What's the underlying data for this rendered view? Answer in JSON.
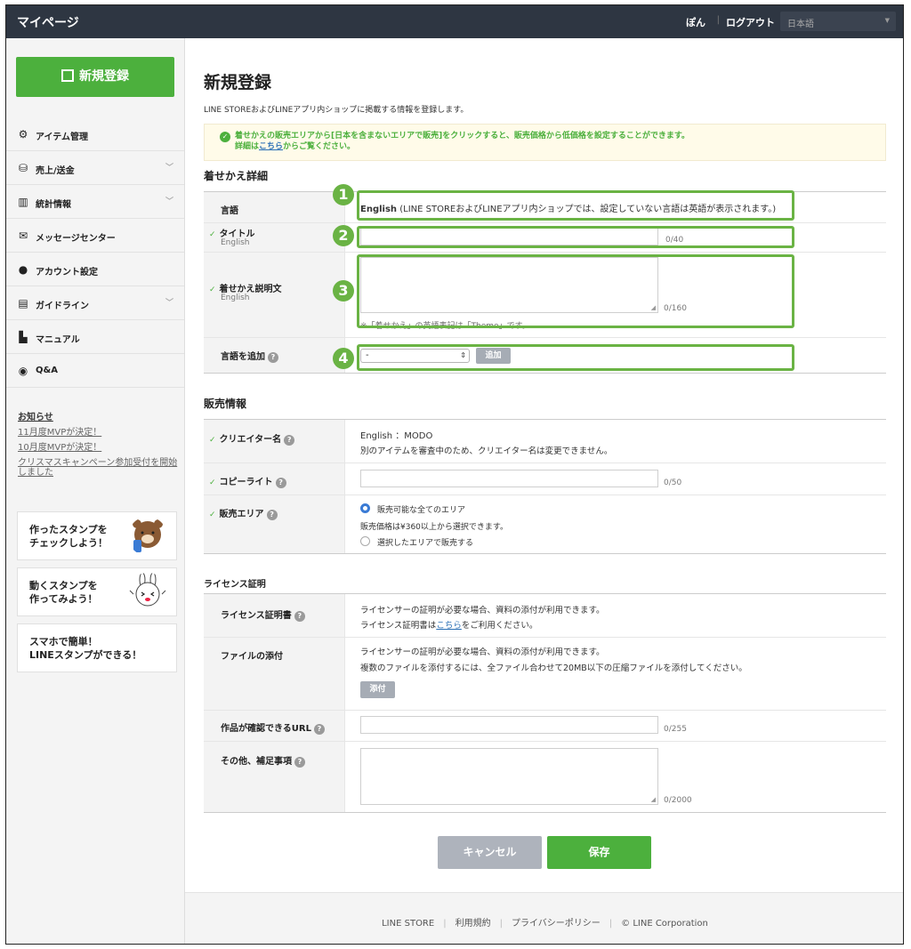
{
  "topbar": {
    "title": "マイページ",
    "user": "ぽん",
    "separator": "|",
    "logout": "ログアウト",
    "language": "日本語"
  },
  "sidebar": {
    "new_button": "新規登録",
    "menu": [
      {
        "label": "アイテム管理",
        "icon": "gear-icon"
      },
      {
        "label": "売上/送金",
        "icon": "coins-icon",
        "chevron": "﹀"
      },
      {
        "label": "統計情報",
        "icon": "bar-chart-icon",
        "chevron": "﹀"
      },
      {
        "label": "メッセージセンター",
        "icon": "envelope-icon"
      },
      {
        "label": "アカウント設定",
        "icon": "person-icon"
      },
      {
        "label": "ガイドライン",
        "icon": "document-icon",
        "chevron": "﹀"
      },
      {
        "label": "マニュアル",
        "icon": "file-icon"
      },
      {
        "label": "Q&A",
        "icon": "speech-bubble-icon"
      }
    ],
    "notice": {
      "heading": "お知らせ",
      "links": [
        "11月度MVPが決定！",
        "10月度MVPが決定！",
        "クリスマスキャンペーン参加受付を開始しました"
      ]
    },
    "banners": [
      {
        "line1": "作ったスタンプを",
        "line2": "チェックしよう！"
      },
      {
        "line1": "動くスタンプを",
        "line2": "作ってみよう！"
      },
      {
        "line1": "スマホで簡単！",
        "line2": "LINEスタンプができる！"
      }
    ]
  },
  "main": {
    "title": "新規登録",
    "subtitle": "LINE STOREおよびLINEアプリ内ショップに掲載する情報を登録します。",
    "alert": {
      "line1": "着せかえの販売エリアから[日本を含まないエリアで販売]をクリックすると、販売価格から低価格を設定することができます。",
      "line2_pre": "詳細は",
      "line2_link": "こちら",
      "line2_post": "からご覧ください。"
    },
    "theme_section": {
      "heading": "着せかえ詳細",
      "language_label": "言語",
      "language_value": "English",
      "language_note": "(LINE STOREおよびLINEアプリ内ショップでは、設定していない言語は英語が表示されます。)",
      "title_label": "タイトル",
      "title_sub": "English",
      "title_counter": "0/40",
      "desc_label": "着せかえ説明文",
      "desc_sub": "English",
      "desc_counter": "0/160",
      "desc_note": "※「着せかえ」の英語表記は「Theme」です。",
      "add_lang_label": "言語を追加",
      "add_lang_select": "-",
      "add_button": "追加",
      "badges": [
        "1",
        "2",
        "3",
        "4"
      ]
    },
    "sales_section": {
      "heading": "販売情報",
      "creator_label": "クリエイター名",
      "creator_value": "English ：MODO",
      "creator_note": "別のアイテムを審査中のため、クリエイター名は変更できません。",
      "copyright_label": "コピーライト",
      "copyright_counter": "0/50",
      "area_label": "販売エリア",
      "area_option1": "販売可能な全てのエリア",
      "area_price_note": "販売価格は¥360以上から選択できます。",
      "area_option2": "選択したエリアで販売する"
    },
    "license_section": {
      "heading": "ライセンス証明",
      "cert_label": "ライセンス証明書",
      "cert_line1": "ライセンサーの証明が必要な場合、資料の添付が利用できます。",
      "cert_line2_pre": "ライセンス証明書は",
      "cert_line2_link": "こちら",
      "cert_line2_post": "をご利用ください。",
      "file_label": "ファイルの添付",
      "file_line1": "ライセンサーの証明が必要な場合、資料の添付が利用できます。",
      "file_line2": "複数のファイルを添付するには、全ファイル合わせて20MB以下の圧縮ファイルを添付してください。",
      "attach_button": "添付",
      "url_label": "作品が確認できるURL",
      "url_counter": "0/255",
      "other_label": "その他、補足事項",
      "other_counter": "0/2000"
    },
    "cancel_button": "キャンセル",
    "save_button": "保存"
  },
  "footer": {
    "links": [
      "LINE STORE",
      "利用規約",
      "プライバシーポリシー",
      "© LINE Corporation"
    ]
  },
  "colors": {
    "accent": "#4cb03d",
    "topbar": "#2e3642",
    "highlight": "#6ab344"
  }
}
